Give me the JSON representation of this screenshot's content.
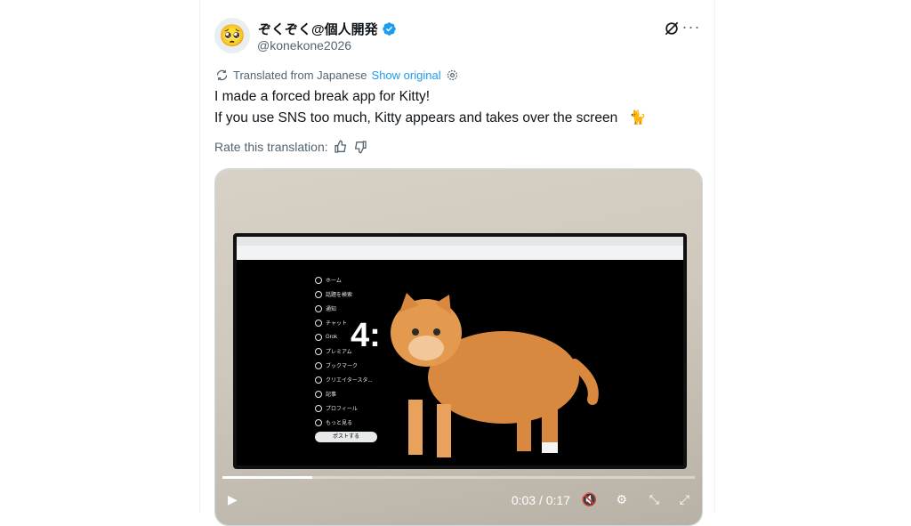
{
  "author": {
    "display_name": "ぞくぞく@個人開発",
    "handle": "@konekone2026",
    "avatar_emoji": "🥺",
    "verified": true
  },
  "translation": {
    "notice": "Translated from Japanese",
    "show_original": "Show original"
  },
  "tweet": {
    "line1": "I made a forced break app for Kitty!",
    "line2": "If you use SNS too much, Kitty appears and takes over the screen",
    "emoji": "🐈"
  },
  "rate": {
    "label": "Rate this translation:"
  },
  "video": {
    "time": "0:03 / 0:17",
    "progress": 0.19,
    "screen_clock": "4:",
    "sidebar_items": [
      "ホーム",
      "話題を検索",
      "通知",
      "チャット",
      "Grok",
      "プレミアム",
      "ブックマーク",
      "クリエイタースタ...",
      "記事",
      "プロフィール",
      "もっと見る"
    ],
    "post_label": "ポストする"
  },
  "colors": {
    "accent": "#1d9bf0",
    "text": "#0f1419",
    "muted": "#536471"
  }
}
